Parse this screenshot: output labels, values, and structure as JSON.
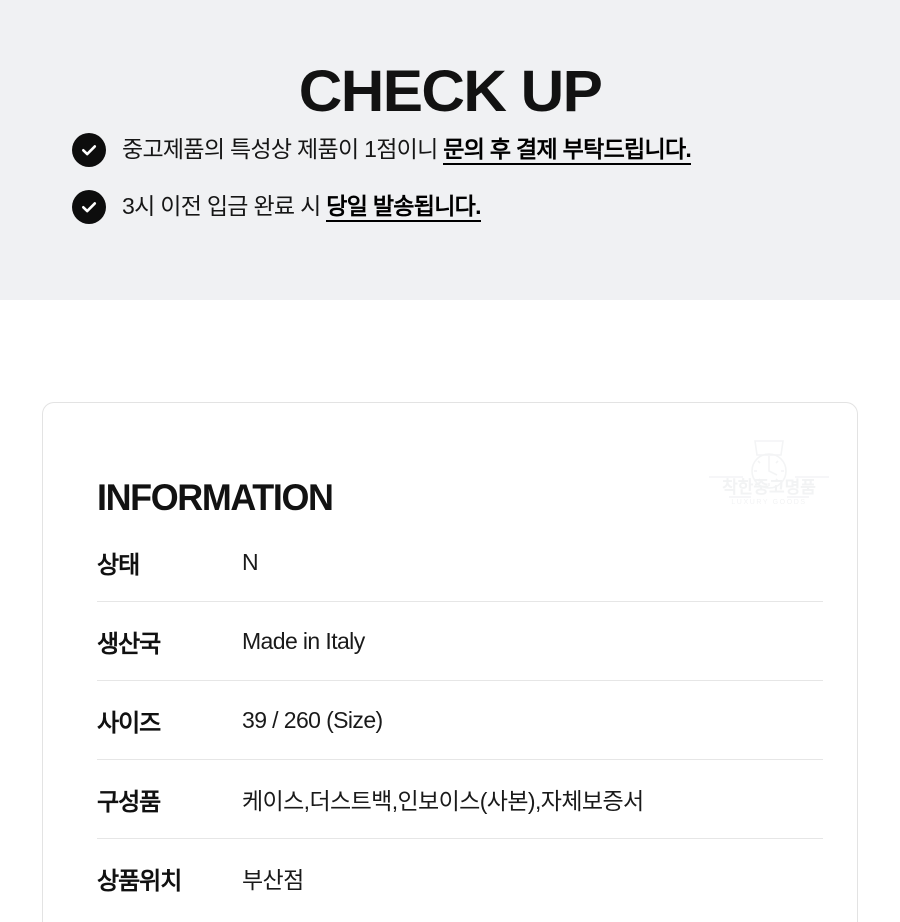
{
  "checkup": {
    "title": "CHECK UP",
    "items": [
      {
        "icon": "check-circle-icon",
        "text_plain": "중고제품의 특성상 제품이 1점이니 ",
        "text_emphasis": "문의 후 결제 부탁드립니다."
      },
      {
        "icon": "check-circle-icon",
        "text_plain": "3시 이전 입금 완료 시 ",
        "text_emphasis": "당일 발송됩니다."
      }
    ]
  },
  "information": {
    "heading": "INFORMATION",
    "watermark": {
      "brand_ko": "착한중고명품",
      "brand_en": "LUXURY GOODS",
      "icon": "watch-icon"
    },
    "rows": [
      {
        "label": "상태",
        "value": "N"
      },
      {
        "label": "생산국",
        "value": "Made in Italy"
      },
      {
        "label": "사이즈",
        "value": "39 / 260 (Size)"
      },
      {
        "label": "구성품",
        "value": "케이스,더스트백,인보이스(사본),자체보증서"
      },
      {
        "label": "상품위치",
        "value": "부산점"
      }
    ]
  },
  "colors": {
    "panel_background": "#f0f1f3",
    "page_background": "#ffffff",
    "text_primary": "#121212",
    "accent_dark": "#0d0d0d",
    "divider": "#e6e6e6",
    "card_border": "#e3e3e3",
    "watermark": "#f4f5f6"
  }
}
